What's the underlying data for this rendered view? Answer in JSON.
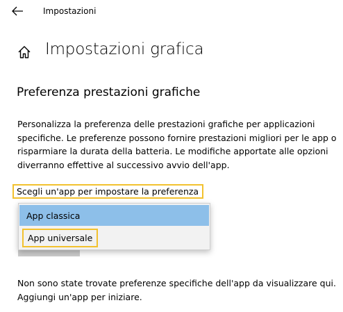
{
  "window": {
    "title": "Impostazioni"
  },
  "header": {
    "title": "Impostazioni grafica"
  },
  "section": {
    "title": "Preferenza prestazioni grafiche",
    "description": "Personalizza la preferenza delle prestazioni grafiche per applicazioni specifiche. Le preferenze possono fornire prestazioni migliori per le app o risparmiare la durata della batteria. Le modifiche apportate alle opzioni diverranno effettive al successivo avvio dell'app."
  },
  "app_type_picker": {
    "label": "Scegli un'app per impostare la preferenza",
    "options": [
      {
        "label": "App classica",
        "selected": true
      },
      {
        "label": "App universale",
        "selected": false
      }
    ]
  },
  "empty_state": {
    "text": "Non sono state trovate preferenze specifiche dell'app da visualizzare qui. Aggiungi un'app per iniziare."
  },
  "colors": {
    "selected_item": "#8dbfe9",
    "highlight_outline": "#f2c12e",
    "menu_background": "#f2f2f2"
  },
  "icons": [
    "back-arrow-icon",
    "home-icon"
  ]
}
